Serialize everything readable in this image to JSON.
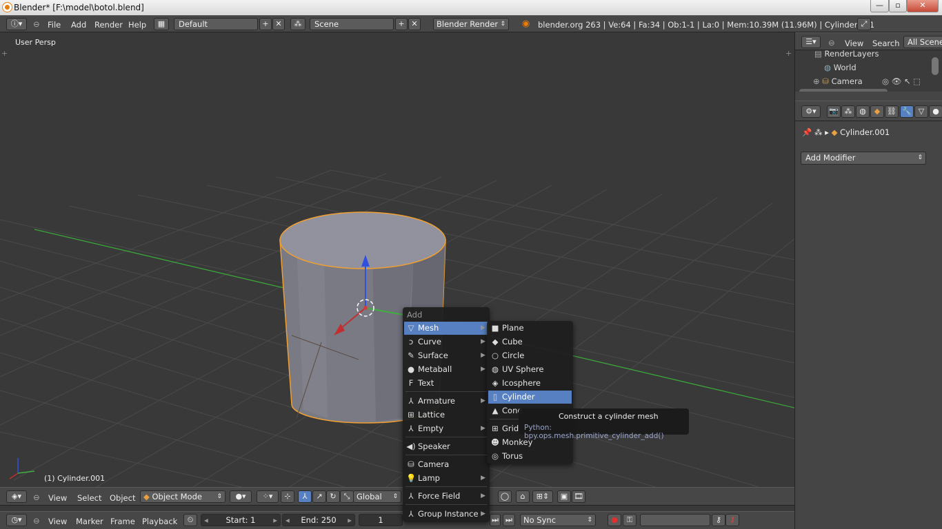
{
  "window": {
    "title": "Blender* [F:\\model\\botol.blend]",
    "min": "—",
    "max": "▫",
    "close": "✕"
  },
  "info_header": {
    "menus": [
      "File",
      "Add",
      "Render",
      "Help"
    ],
    "screen_layout": "Default",
    "scene": "Scene",
    "render_engine": "Blender Render",
    "stats": "blender.org 263 | Ve:64 | Fa:34 | Ob:1-1 | La:0 | Mem:10.39M (11.96M) | Cylinder.001"
  },
  "viewport": {
    "view_label": "User Persp",
    "object_label": "(1) Cylinder.001",
    "header": {
      "menus": [
        "View",
        "Select",
        "Object"
      ],
      "mode": "Object Mode",
      "orientation": "Global"
    }
  },
  "timeline": {
    "menus": [
      "View",
      "Marker",
      "Frame",
      "Playback"
    ],
    "start": "Start: 1",
    "end": "End: 250",
    "current": "1",
    "sync": "No Sync"
  },
  "outliner": {
    "menus": [
      "View",
      "Search"
    ],
    "filter": "All Scenes",
    "items": [
      "RenderLayers",
      "World",
      "Camera"
    ]
  },
  "properties": {
    "object": "Cylinder.001",
    "add_modifier": "Add Modifier"
  },
  "add_menu": {
    "title": "Add",
    "items": [
      "Mesh",
      "Curve",
      "Surface",
      "Metaball",
      "Text",
      "Armature",
      "Lattice",
      "Empty",
      "Speaker",
      "Camera",
      "Lamp",
      "Force Field",
      "Group Instance"
    ],
    "selected": "Mesh"
  },
  "mesh_menu": {
    "items": [
      "Plane",
      "Cube",
      "Circle",
      "UV Sphere",
      "Icosphere",
      "Cylinder",
      "Cone",
      "Grid",
      "Monkey",
      "Torus"
    ],
    "selected": "Cylinder"
  },
  "tooltip": {
    "title": "Construct a cylinder mesh",
    "python": "Python: bpy.ops.mesh.primitive_cylinder_add()"
  },
  "colors": {
    "selection": "#5680c2",
    "object_outline": "#f0a030",
    "x_axis": "#c03030",
    "y_axis": "#40b040",
    "z_axis": "#3050e0"
  }
}
